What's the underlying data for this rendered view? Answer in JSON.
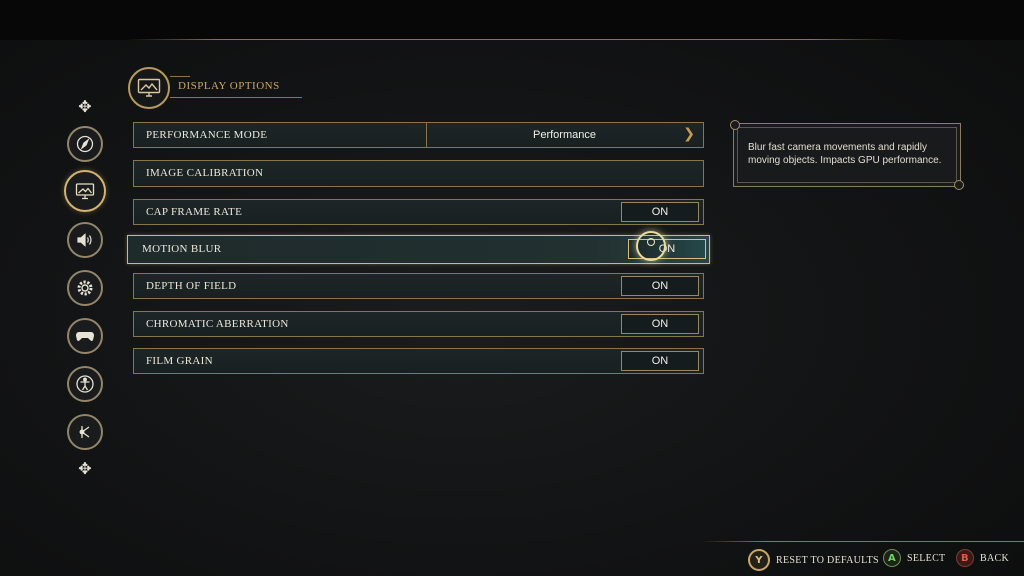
{
  "header": {
    "title": "DISPLAY OPTIONS"
  },
  "nav": {
    "items": [
      {
        "icon": "compass-icon"
      },
      {
        "icon": "display-icon",
        "active": true
      },
      {
        "icon": "speaker-icon"
      },
      {
        "icon": "gear-icon"
      },
      {
        "icon": "controller-icon"
      },
      {
        "icon": "accessibility-icon"
      },
      {
        "icon": "network-icon"
      }
    ]
  },
  "settings": {
    "performance_mode": {
      "label": "PERFORMANCE MODE",
      "value": "Performance"
    },
    "image_calibration": {
      "label": "IMAGE CALIBRATION"
    },
    "cap_frame_rate": {
      "label": "CAP FRAME RATE",
      "value": "ON"
    },
    "motion_blur": {
      "label": "MOTION BLUR",
      "value": "ON",
      "selected": true
    },
    "depth_of_field": {
      "label": "DEPTH OF FIELD",
      "value": "ON"
    },
    "chromatic_aberration": {
      "label": "CHROMATIC ABERRATION",
      "value": "ON"
    },
    "film_grain": {
      "label": "FILM GRAIN",
      "value": "ON"
    }
  },
  "tooltip": {
    "text": "Blur fast camera movements and rapidly moving objects.  Impacts GPU performance."
  },
  "footer": {
    "reset": {
      "glyph": "Y",
      "label": "RESET TO DEFAULTS"
    },
    "select": {
      "glyph": "A",
      "label": "SELECT"
    },
    "back": {
      "glyph": "B",
      "label": "BACK"
    }
  },
  "colors": {
    "accent_gold": "#c9a766",
    "row_border": "#8a744c",
    "row_bg": "#1b2324",
    "select_green": "#6fd36a",
    "back_red": "#e0594a"
  }
}
